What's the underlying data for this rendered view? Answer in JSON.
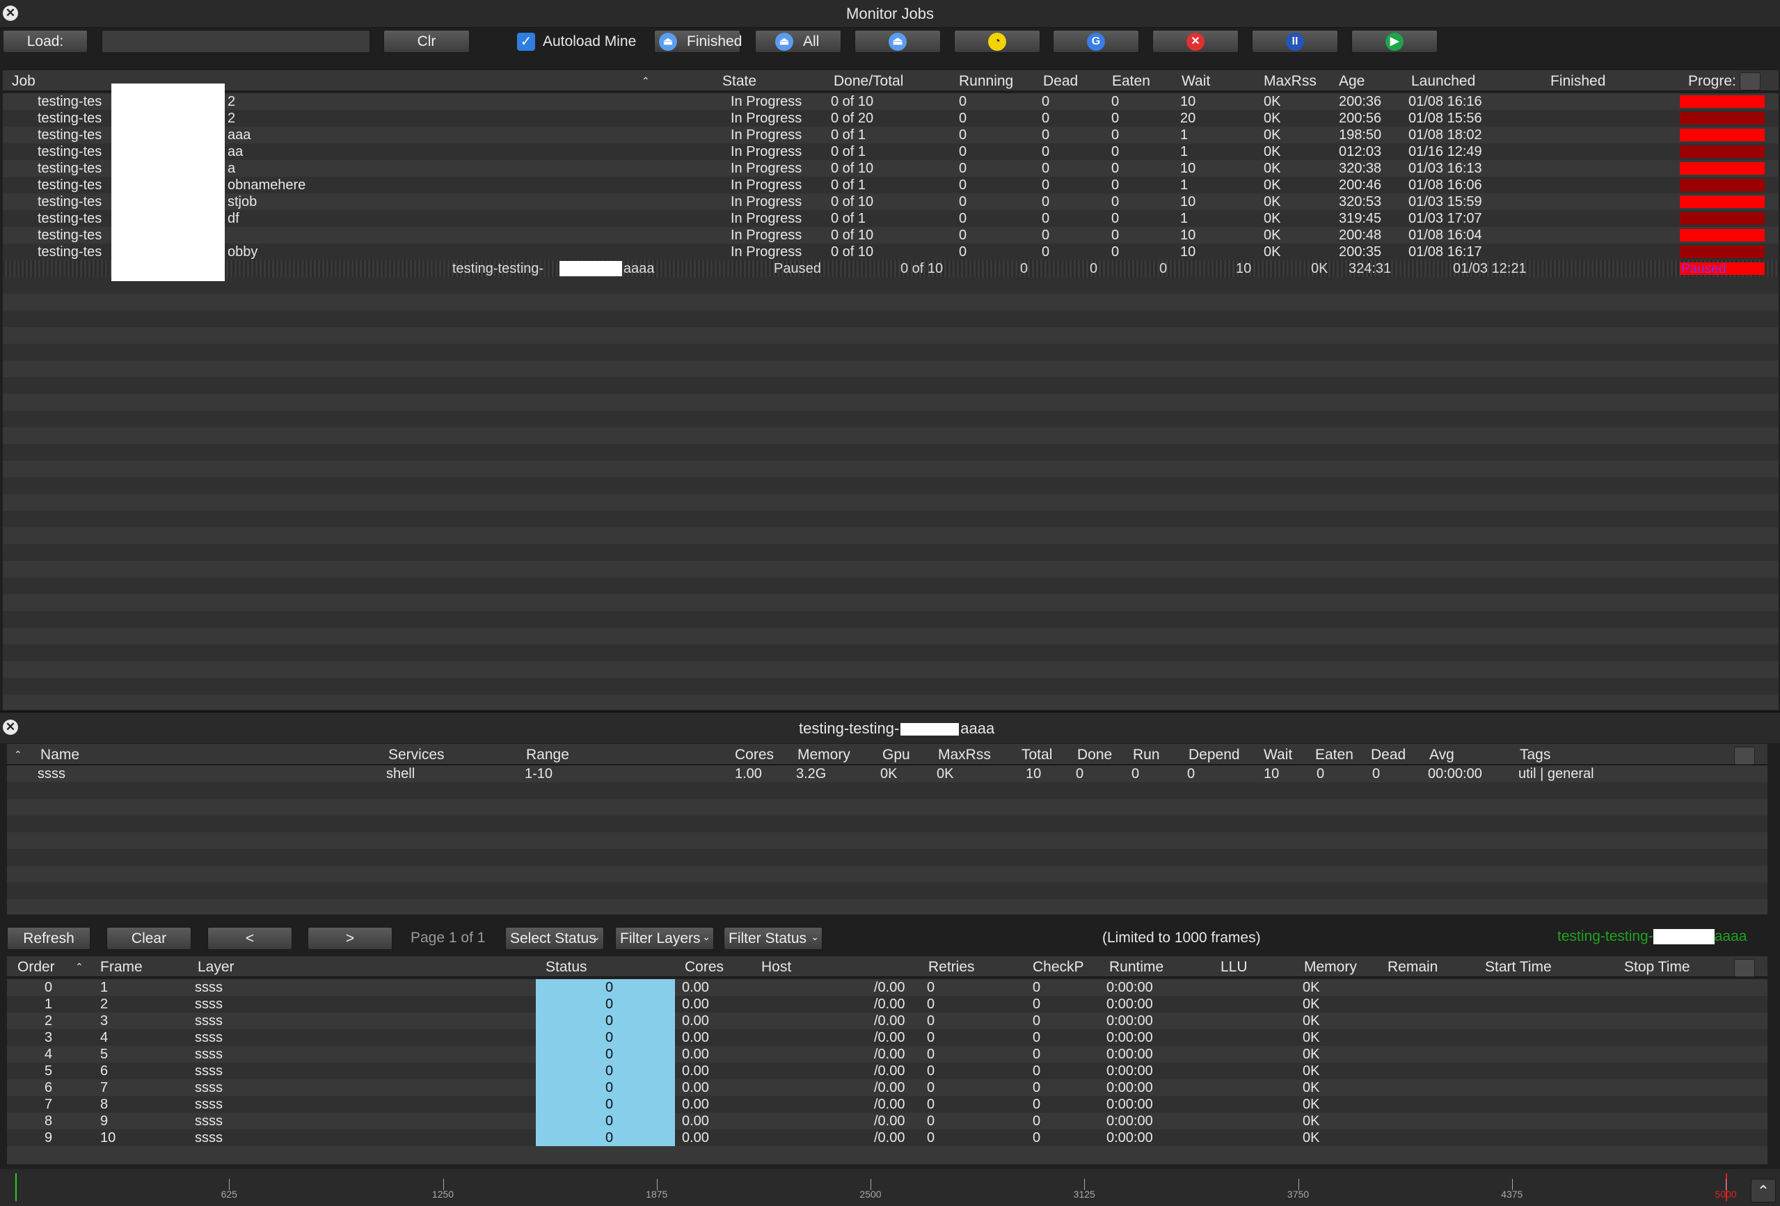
{
  "window_title": "Monitor Jobs",
  "toolbar": {
    "load_label": "Load:",
    "load_value": "",
    "clr_label": "Clr",
    "autoload_label": "Autoload Mine",
    "autoload_checked": true,
    "finished_label": "Finished",
    "all_label": "All",
    "icons": [
      "unmonitor-icon",
      "eat-dead-icon",
      "retry-icon",
      "kill-icon",
      "pause-icon",
      "resume-icon"
    ]
  },
  "jobs_table": {
    "columns": [
      "Job",
      "State",
      "Done/Total",
      "Running",
      "Dead",
      "Eaten",
      "Wait",
      "MaxRss",
      "Age",
      "Launched",
      "Finished",
      "Progre:"
    ],
    "rows": [
      {
        "job": "testing-tes",
        "suffix": "2",
        "state": "In Progress",
        "done": "0 of 10",
        "running": "0",
        "dead": "0",
        "eaten": "0",
        "wait": "10",
        "maxrss": "0K",
        "age": "200:36",
        "launched": "01/08 16:16",
        "finished": ""
      },
      {
        "job": "testing-tes",
        "suffix": "2",
        "state": "In Progress",
        "done": "0 of 20",
        "running": "0",
        "dead": "0",
        "eaten": "0",
        "wait": "20",
        "maxrss": "0K",
        "age": "200:56",
        "launched": "01/08 15:56",
        "finished": ""
      },
      {
        "job": "testing-tes",
        "suffix": "aaa",
        "state": "In Progress",
        "done": "0 of 1",
        "running": "0",
        "dead": "0",
        "eaten": "0",
        "wait": "1",
        "maxrss": "0K",
        "age": "198:50",
        "launched": "01/08 18:02",
        "finished": ""
      },
      {
        "job": "testing-tes",
        "suffix": "aa",
        "state": "In Progress",
        "done": "0 of 1",
        "running": "0",
        "dead": "0",
        "eaten": "0",
        "wait": "1",
        "maxrss": "0K",
        "age": "012:03",
        "launched": "01/16 12:49",
        "finished": ""
      },
      {
        "job": "testing-tes",
        "suffix": "a",
        "state": "In Progress",
        "done": "0 of 10",
        "running": "0",
        "dead": "0",
        "eaten": "0",
        "wait": "10",
        "maxrss": "0K",
        "age": "320:38",
        "launched": "01/03 16:13",
        "finished": ""
      },
      {
        "job": "testing-tes",
        "suffix": "obnamehere",
        "state": "In Progress",
        "done": "0 of 1",
        "running": "0",
        "dead": "0",
        "eaten": "0",
        "wait": "1",
        "maxrss": "0K",
        "age": "200:46",
        "launched": "01/08 16:06",
        "finished": ""
      },
      {
        "job": "testing-tes",
        "suffix": "stjob",
        "state": "In Progress",
        "done": "0 of 10",
        "running": "0",
        "dead": "0",
        "eaten": "0",
        "wait": "10",
        "maxrss": "0K",
        "age": "320:53",
        "launched": "01/03 15:59",
        "finished": ""
      },
      {
        "job": "testing-tes",
        "suffix": "df",
        "state": "In Progress",
        "done": "0 of 1",
        "running": "0",
        "dead": "0",
        "eaten": "0",
        "wait": "1",
        "maxrss": "0K",
        "age": "319:45",
        "launched": "01/03 17:07",
        "finished": ""
      },
      {
        "job": "testing-tes",
        "suffix": "",
        "state": "In Progress",
        "done": "0 of 10",
        "running": "0",
        "dead": "0",
        "eaten": "0",
        "wait": "10",
        "maxrss": "0K",
        "age": "200:48",
        "launched": "01/08 16:04",
        "finished": ""
      },
      {
        "job": "testing-tes",
        "suffix": "obby",
        "state": "In Progress",
        "done": "0 of 10",
        "running": "0",
        "dead": "0",
        "eaten": "0",
        "wait": "10",
        "maxrss": "0K",
        "age": "200:35",
        "launched": "01/08 16:17",
        "finished": ""
      }
    ],
    "paused_row": {
      "job": "testing-testing-",
      "suffix": "aaaa",
      "state": "Paused",
      "done": "0 of 10",
      "running": "0",
      "dead": "0",
      "eaten": "0",
      "wait": "10",
      "maxrss": "0K",
      "age": "324:31",
      "launched": "01/03 12:21",
      "progress": "Paused"
    }
  },
  "layers_panel": {
    "title": "testing-testing-",
    "title_suffix": "aaaa",
    "columns": [
      "Name",
      "Services",
      "Range",
      "Cores",
      "Memory",
      "Gpu",
      "MaxRss",
      "Total",
      "Done",
      "Run",
      "Depend",
      "Wait",
      "Eaten",
      "Dead",
      "Avg",
      "Tags"
    ],
    "rows": [
      {
        "name": "ssss",
        "services": "shell",
        "range": "1-10",
        "cores": "1.00",
        "memory": "3.2G",
        "gpu": "0K",
        "maxrss": "0K",
        "total": "10",
        "done": "0",
        "run": "0",
        "depend": "0",
        "wait": "10",
        "eaten": "0",
        "dead": "0",
        "avg": "00:00:00",
        "tags": "util | general"
      }
    ]
  },
  "frames_toolbar": {
    "refresh_label": "Refresh",
    "clear_label": "Clear",
    "prev_label": "<",
    "next_label": ">",
    "page_label": "Page 1 of 1",
    "select_status_label": "Select Status",
    "filter_layers_label": "Filter Layers",
    "filter_status_label": "Filter Status",
    "limited_label": "(Limited to 1000 frames)",
    "job_label": "testing-testing-",
    "job_label_suffix": "aaaa"
  },
  "frames_table": {
    "columns": [
      "Order",
      "Frame",
      "Layer",
      "Status",
      "Cores",
      "Host",
      "Retries",
      "CheckP",
      "Runtime",
      "LLU",
      "Memory",
      "Remain",
      "Start Time",
      "Stop Time"
    ],
    "rows": [
      {
        "order": "0",
        "frame": "1",
        "layer": "ssss",
        "status": "0",
        "cores": "0.00",
        "host": "/0.00",
        "retries": "0",
        "checkp": "0",
        "runtime": "0:00:00",
        "memory": "0K"
      },
      {
        "order": "1",
        "frame": "2",
        "layer": "ssss",
        "status": "0",
        "cores": "0.00",
        "host": "/0.00",
        "retries": "0",
        "checkp": "0",
        "runtime": "0:00:00",
        "memory": "0K"
      },
      {
        "order": "2",
        "frame": "3",
        "layer": "ssss",
        "status": "0",
        "cores": "0.00",
        "host": "/0.00",
        "retries": "0",
        "checkp": "0",
        "runtime": "0:00:00",
        "memory": "0K"
      },
      {
        "order": "3",
        "frame": "4",
        "layer": "ssss",
        "status": "0",
        "cores": "0.00",
        "host": "/0.00",
        "retries": "0",
        "checkp": "0",
        "runtime": "0:00:00",
        "memory": "0K"
      },
      {
        "order": "4",
        "frame": "5",
        "layer": "ssss",
        "status": "0",
        "cores": "0.00",
        "host": "/0.00",
        "retries": "0",
        "checkp": "0",
        "runtime": "0:00:00",
        "memory": "0K"
      },
      {
        "order": "5",
        "frame": "6",
        "layer": "ssss",
        "status": "0",
        "cores": "0.00",
        "host": "/0.00",
        "retries": "0",
        "checkp": "0",
        "runtime": "0:00:00",
        "memory": "0K"
      },
      {
        "order": "6",
        "frame": "7",
        "layer": "ssss",
        "status": "0",
        "cores": "0.00",
        "host": "/0.00",
        "retries": "0",
        "checkp": "0",
        "runtime": "0:00:00",
        "memory": "0K"
      },
      {
        "order": "7",
        "frame": "8",
        "layer": "ssss",
        "status": "0",
        "cores": "0.00",
        "host": "/0.00",
        "retries": "0",
        "checkp": "0",
        "runtime": "0:00:00",
        "memory": "0K"
      },
      {
        "order": "8",
        "frame": "9",
        "layer": "ssss",
        "status": "0",
        "cores": "0.00",
        "host": "/0.00",
        "retries": "0",
        "checkp": "0",
        "runtime": "0:00:00",
        "memory": "0K"
      },
      {
        "order": "9",
        "frame": "10",
        "layer": "ssss",
        "status": "0",
        "cores": "0.00",
        "host": "/0.00",
        "retries": "0",
        "checkp": "0",
        "runtime": "0:00:00",
        "memory": "0K"
      }
    ]
  },
  "timeline": {
    "ticks": [
      "625",
      "1250",
      "1875",
      "2500",
      "3125",
      "3750",
      "4375",
      "5000"
    ]
  },
  "colors": {
    "progress_red": "#ff0000",
    "progress_darkred": "#9b0000",
    "status_blue": "#87ceeb",
    "green_text": "#1fa31f",
    "paused_text": "#8a2be2"
  }
}
